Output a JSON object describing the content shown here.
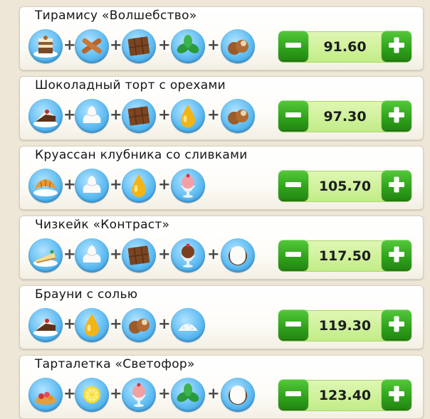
{
  "recipes": [
    {
      "name": "Тирамису «Волшебство»",
      "price": "91.60",
      "ingredients": [
        "tiramisu-cake-icon",
        "cinnamon-icon",
        "chocolate-bar-icon",
        "mint-icon",
        "hazelnut-icon"
      ]
    },
    {
      "name": "Шоколадный торт с орехами",
      "price": "97.30",
      "ingredients": [
        "chocolate-cake-icon",
        "whipped-cream-icon",
        "chocolate-bar-icon",
        "oil-drop-icon",
        "hazelnut-icon"
      ]
    },
    {
      "name": "Круассан клубника со сливками",
      "price": "105.70",
      "ingredients": [
        "croissant-icon",
        "whipped-cream-icon",
        "oil-drop-icon",
        "strawberry-ice-cream-icon"
      ]
    },
    {
      "name": "Чизкейк  «Контраст»",
      "price": "117.50",
      "ingredients": [
        "cheesecake-icon",
        "whipped-cream-icon",
        "chocolate-bar-icon",
        "chocolate-ice-cream-icon",
        "coconut-icon"
      ]
    },
    {
      "name": "Брауни с солью",
      "price": "119.30",
      "ingredients": [
        "brownie-icon",
        "oil-drop-icon",
        "hazelnut-icon",
        "salt-icon"
      ]
    },
    {
      "name": "Тарталетка «Светофор»",
      "price": "123.40",
      "ingredients": [
        "tartlet-icon",
        "lemon-icon",
        "strawberry-ice-cream-icon",
        "mint-icon",
        "coconut-icon"
      ]
    }
  ],
  "colors": {
    "background": "#eee7d7",
    "stepper_bg": "#c1ec86",
    "button_green": "#2fa21b",
    "ingredient_circle": "#5fbcf2"
  }
}
